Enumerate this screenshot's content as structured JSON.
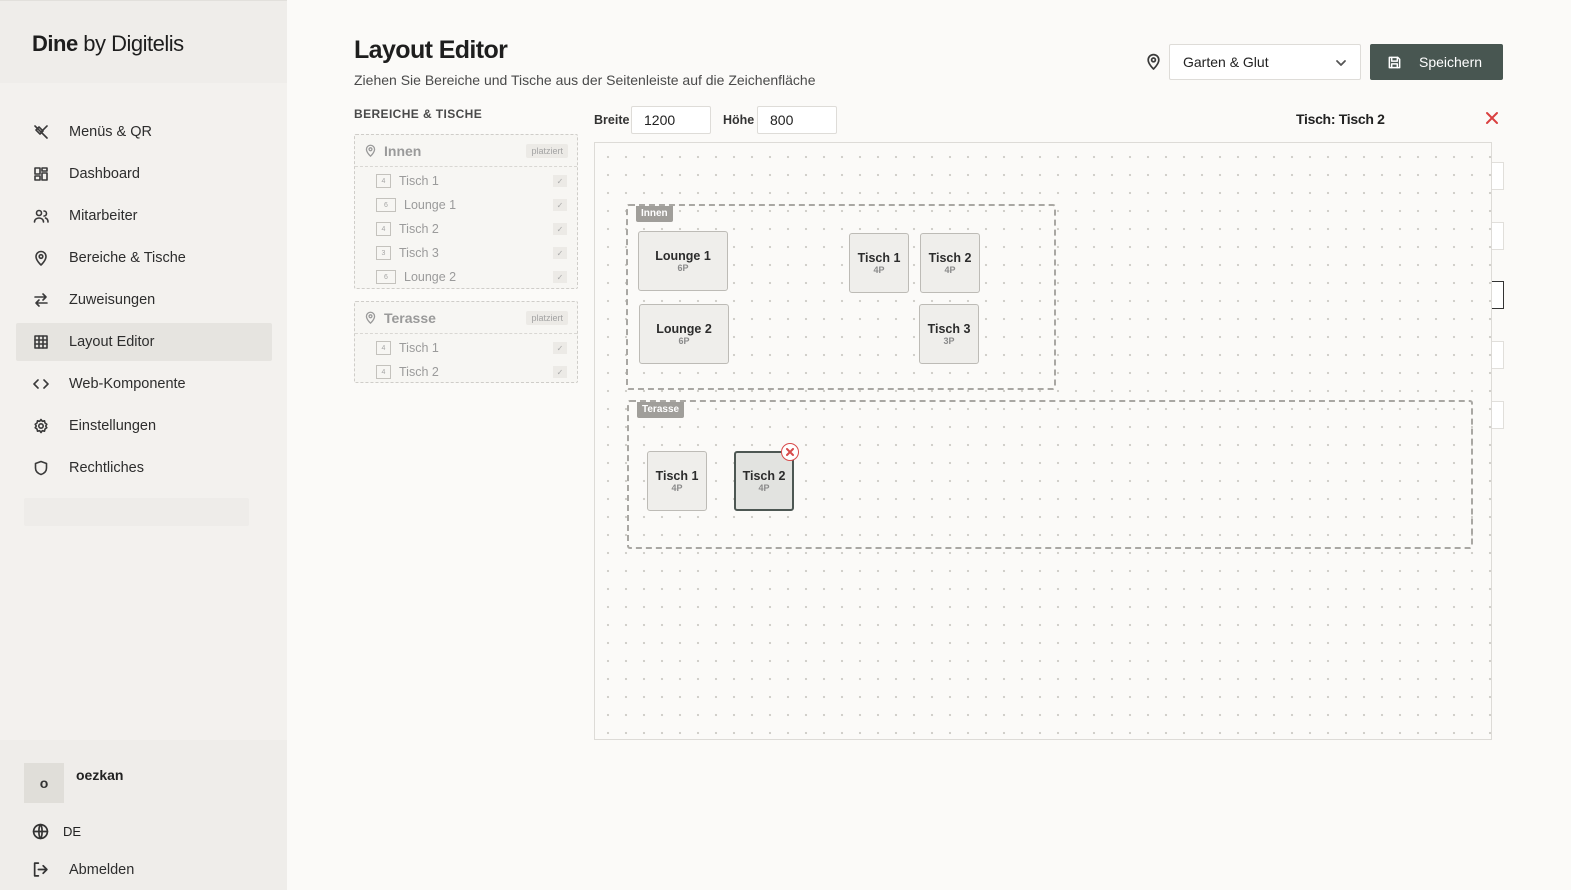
{
  "brand": {
    "strong": "Dine",
    "rest": " by Digitelis"
  },
  "nav": [
    {
      "label": "Menüs & QR",
      "icon": "utensils-icon"
    },
    {
      "label": "Dashboard",
      "icon": "grid-icon"
    },
    {
      "label": "Mitarbeiter",
      "icon": "users-icon"
    },
    {
      "label": "Bereiche & Tische",
      "icon": "map-pin-icon"
    },
    {
      "label": "Zuweisungen",
      "icon": "arrows-icon"
    },
    {
      "label": "Layout Editor",
      "icon": "table-grid-icon"
    },
    {
      "label": "Web-Komponente",
      "icon": "code-icon"
    },
    {
      "label": "Einstellungen",
      "icon": "gear-icon"
    },
    {
      "label": "Rechtliches",
      "icon": "shield-icon"
    }
  ],
  "user": {
    "initial": "o",
    "name": "oezkan",
    "language": "DE",
    "logout": "Abmelden"
  },
  "header": {
    "title": "Layout Editor",
    "subtitle": "Ziehen Sie Bereiche und Tische aus der Seitenleiste auf die Zeichenfläche",
    "location": "Garten & Glut",
    "save": "Speichern"
  },
  "panel": {
    "title": "BEREICHE & TISCHE",
    "areas": [
      {
        "name": "Innen",
        "badge": "platziert",
        "tables": [
          {
            "name": "Tisch 1",
            "cap": "4"
          },
          {
            "name": "Lounge 1",
            "cap": "6"
          },
          {
            "name": "Tisch 2",
            "cap": "4"
          },
          {
            "name": "Tisch 3",
            "cap": "3"
          },
          {
            "name": "Lounge 2",
            "cap": "6"
          }
        ]
      },
      {
        "name": "Terasse",
        "badge": "platziert",
        "tables": [
          {
            "name": "Tisch 1",
            "cap": "4"
          },
          {
            "name": "Tisch 2",
            "cap": "4"
          }
        ]
      }
    ],
    "check": "✓"
  },
  "toolbar": {
    "width_label": "Breite",
    "width": "1200",
    "height_label": "Höhe",
    "height": "800"
  },
  "selection": {
    "title": "Tisch: Tisch 2"
  },
  "canvas": {
    "zones": [
      {
        "label": "Innen",
        "tables": [
          {
            "name": "Lounge 1",
            "cap": "6P"
          },
          {
            "name": "Tisch 1",
            "cap": "4P"
          },
          {
            "name": "Tisch 2",
            "cap": "4P"
          },
          {
            "name": "Lounge 2",
            "cap": "6P"
          },
          {
            "name": "Tisch 3",
            "cap": "3P"
          }
        ]
      },
      {
        "label": "Terasse",
        "tables": [
          {
            "name": "Tisch 1",
            "cap": "4P"
          },
          {
            "name": "Tisch 2",
            "cap": "4P",
            "selected": true
          }
        ]
      }
    ]
  },
  "colors": {
    "accent": "#485651",
    "danger": "#d94040"
  }
}
